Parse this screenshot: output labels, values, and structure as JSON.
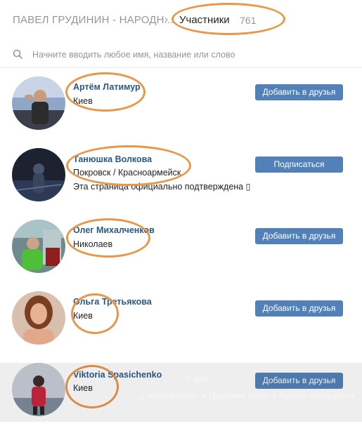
{
  "header": {
    "group_title": "ПАВЕЛ ГРУДИНИН - НАРОДН...",
    "separator": "›",
    "current": "Участники",
    "count": "761"
  },
  "search": {
    "placeholder": "Начните вводить любое имя, название или слово"
  },
  "members": [
    {
      "name": "Артём Латимур",
      "city": "Киев",
      "note": "",
      "button": "Добавить в друзья"
    },
    {
      "name": "Танюшка Волкова",
      "city": "Покровск / Красноармейск",
      "note": "Эта страница официально подтверждена ▯",
      "button": "Подписаться"
    },
    {
      "name": "Олег Михалченков",
      "city": "Николаев",
      "note": "",
      "button": "Добавить в друзья"
    },
    {
      "name": "Ольга Третьякова",
      "city": "Киев",
      "note": "",
      "button": "Добавить в друзья"
    },
    {
      "name": "Viktoria Spasichenko",
      "city": "Киев",
      "note": "",
      "button": "Добавить в друзья"
    }
  ],
  "overlay": {
    "line1": "...у меня вопрос. А Грудинин точно в России собирается",
    "line2": "...9 мин"
  },
  "colors": {
    "accent": "#5181b8",
    "link": "#2a5885",
    "highlight": "#e8974a"
  }
}
